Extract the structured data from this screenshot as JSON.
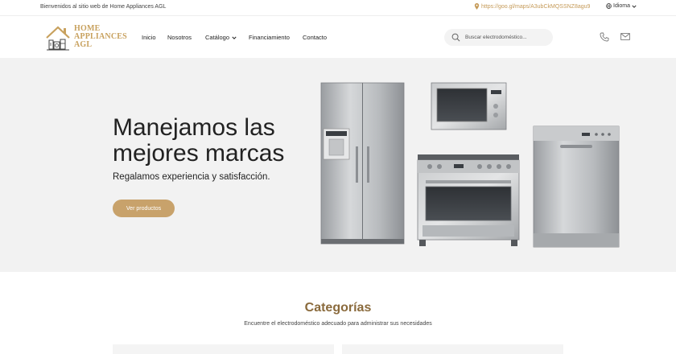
{
  "topbar": {
    "welcome": "Bienvenidos al sitio web de Home Appliances AGL",
    "map_link": "https://goo.gl/maps/A3ubCkMQSSNZ8agu9",
    "language": "Idioma"
  },
  "header": {
    "logo_line1": "HOME",
    "logo_line2": "APPLIANCES",
    "logo_line3": "AGL",
    "nav": {
      "inicio": "Inicio",
      "nosotros": "Nosotros",
      "catalogo": "Catálogo",
      "financiamiento": "Financiamiento",
      "contacto": "Contacto"
    },
    "search_placeholder": "Buscar electrodoméstico..."
  },
  "hero": {
    "title": "Manejamos las mejores marcas",
    "subtitle": "Regalamos experiencia y satisfacción.",
    "button": "Ver productos"
  },
  "categories": {
    "title": "Categorías",
    "subtitle": "Encuentre el electrodoméstico adecuado para administrar sus necesidades"
  },
  "colors": {
    "accent": "#c8a26b",
    "accent_dark": "#8a6a3c",
    "hero_bg": "#f2f2f2"
  },
  "icons": [
    "map-pin-icon",
    "globe-icon",
    "chevron-down-icon",
    "search-icon",
    "phone-icon",
    "mail-icon"
  ]
}
